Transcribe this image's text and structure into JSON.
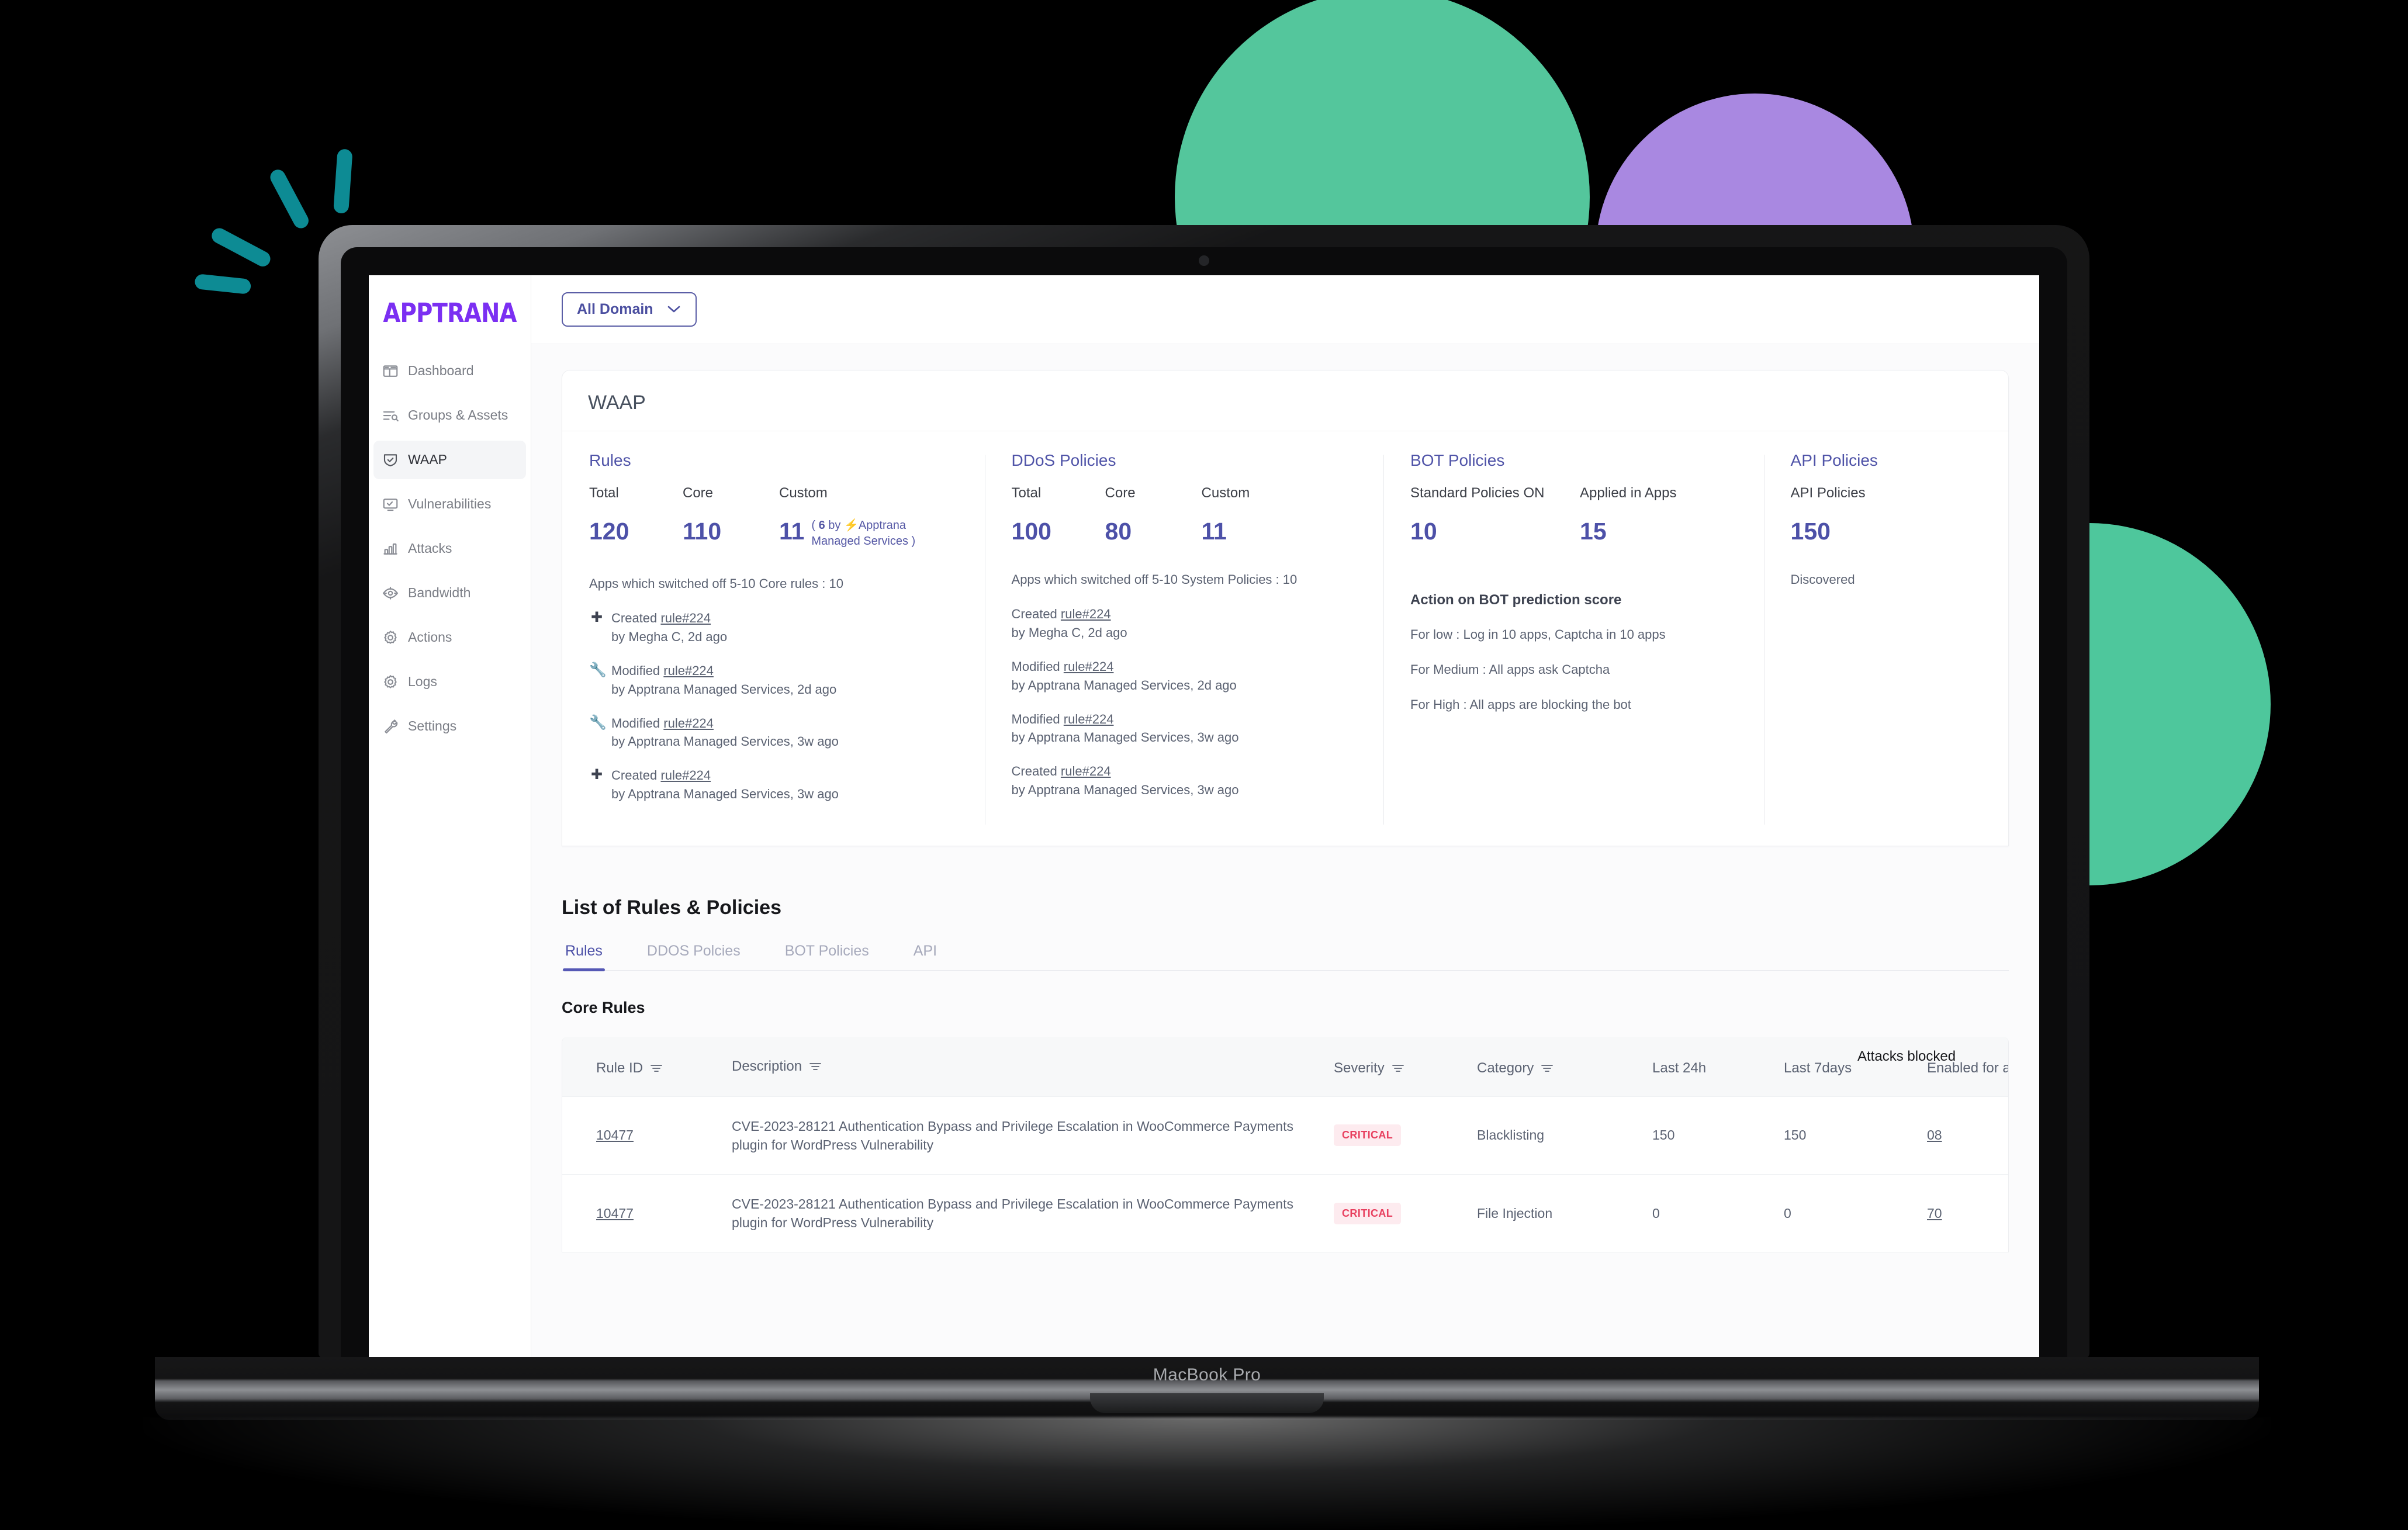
{
  "device": {
    "label": "MacBook Pro"
  },
  "brand": {
    "name": "APPTRANA",
    "color": "#7b2ff2"
  },
  "sidebar": {
    "items": [
      {
        "label": "Dashboard",
        "icon": "dashboard-icon",
        "active": false
      },
      {
        "label": "Groups &\nAssets",
        "icon": "groups-assets-icon",
        "active": false
      },
      {
        "label": "WAAP",
        "icon": "shield-check-icon",
        "active": true
      },
      {
        "label": "Vulnerabilities",
        "icon": "monitor-check-icon",
        "active": false
      },
      {
        "label": "Attacks",
        "icon": "bar-chart-icon",
        "active": false
      },
      {
        "label": "Bandwidth",
        "icon": "bandwidth-eye-icon",
        "active": false
      },
      {
        "label": "Actions",
        "icon": "gear-icon",
        "active": false
      },
      {
        "label": "Logs",
        "icon": "gear-icon",
        "active": false
      },
      {
        "label": "Settings",
        "icon": "wrench-icon",
        "active": false
      }
    ]
  },
  "topbar": {
    "domain_selected": "All Domain",
    "chevron": "chevron-down-icon"
  },
  "waap": {
    "title": "WAAP",
    "rules": {
      "title": "Rules",
      "stats": [
        {
          "label": "Total",
          "value": "120"
        },
        {
          "label": "Core",
          "value": "110"
        },
        {
          "label": "Custom",
          "value": "11"
        }
      ],
      "custom_note_pre": "( ",
      "custom_note_count": "6",
      "custom_note_mid": " by ",
      "custom_note_tail": "Apptrana Managed Services )",
      "switched_off": "Apps which switched off 5-10 Core rules : 10",
      "activity": [
        {
          "icon": "plus-icon",
          "action": "Created",
          "link": "rule#224",
          "by": "by Megha C, 2d ago"
        },
        {
          "icon": "wrench-icon",
          "action": "Modified",
          "link": "rule#224",
          "by": "by Apptrana Managed Services, 2d ago"
        },
        {
          "icon": "wrench-icon",
          "action": "Modified",
          "link": "rule#224",
          "by": "by Apptrana Managed Services, 3w ago"
        },
        {
          "icon": "plus-icon",
          "action": "Created",
          "link": "rule#224",
          "by": "by Apptrana Managed Services, 3w ago"
        }
      ]
    },
    "ddos": {
      "title": "DDoS Policies",
      "stats": [
        {
          "label": "Total",
          "value": "100"
        },
        {
          "label": "Core",
          "value": "80"
        },
        {
          "label": "Custom",
          "value": "11"
        }
      ],
      "switched_off": "Apps which switched off 5-10 System Policies : 10",
      "activity": [
        {
          "action": "Created",
          "link": "rule#224",
          "by": "by Megha C, 2d ago"
        },
        {
          "action": "Modified",
          "link": "rule#224",
          "by": "by Apptrana Managed Services, 2d ago"
        },
        {
          "action": "Modified",
          "link": "rule#224",
          "by": "by Apptrana Managed Services, 3w ago"
        },
        {
          "action": "Created",
          "link": "rule#224",
          "by": "by Apptrana Managed Services, 3w ago"
        }
      ]
    },
    "bot": {
      "title": "BOT Policies",
      "stats": [
        {
          "label": "Standard Policies ON",
          "value": "10"
        },
        {
          "label": "Applied in Apps",
          "value": "15"
        }
      ],
      "action_head": "Action on BOT prediction score",
      "lines": [
        "For low : Log in 10 apps, Captcha in 10 apps",
        "For Medium : All apps ask Captcha",
        "For High : All apps are blocking the bot"
      ]
    },
    "api": {
      "title": "API Policies",
      "stats": [
        {
          "label": "API Policies",
          "value": "150"
        }
      ],
      "discovered": "Discovered"
    }
  },
  "list": {
    "title": "List of Rules & Policies",
    "tabs": [
      {
        "label": "Rules",
        "active": true
      },
      {
        "label": "DDOS Polcies",
        "active": false
      },
      {
        "label": "BOT Policies",
        "active": false
      },
      {
        "label": "API",
        "active": false
      }
    ],
    "section_title": "Core Rules",
    "group_header": "Attacks blocked",
    "columns": [
      {
        "label": "Rule ID",
        "filter": true
      },
      {
        "label": "Description",
        "filter": true
      },
      {
        "label": "Severity",
        "filter": true
      },
      {
        "label": "Category",
        "filter": true
      },
      {
        "label": "Last 24h",
        "filter": false
      },
      {
        "label": "Last 7days",
        "filter": false
      },
      {
        "label": "Enabled for a",
        "filter": false
      }
    ],
    "rows": [
      {
        "rule_id": "10477",
        "description": "CVE-2023-28121 Authentication Bypass and Privilege Escalation in WooCommerce Payments plugin for WordPress Vulnerability",
        "severity": "CRITICAL",
        "category": "Blacklisting",
        "last_24h": "150",
        "last_7days": "150",
        "enabled_for": "08"
      },
      {
        "rule_id": "10477",
        "description": "CVE-2023-28121 Authentication Bypass and Privilege Escalation in WooCommerce Payments plugin for WordPress Vulnerability",
        "severity": "CRITICAL",
        "category": "File Injection",
        "last_24h": "0",
        "last_7days": "0",
        "enabled_for": "70"
      }
    ]
  },
  "colors": {
    "accent_purple": "#5558b5",
    "brand_purple": "#7b2ff2",
    "critical_text": "#e8405f",
    "critical_bg": "#fdebef",
    "deco_green": "#54c69c",
    "deco_purple": "#b794f4",
    "deco_teal": "#0d8b94"
  }
}
